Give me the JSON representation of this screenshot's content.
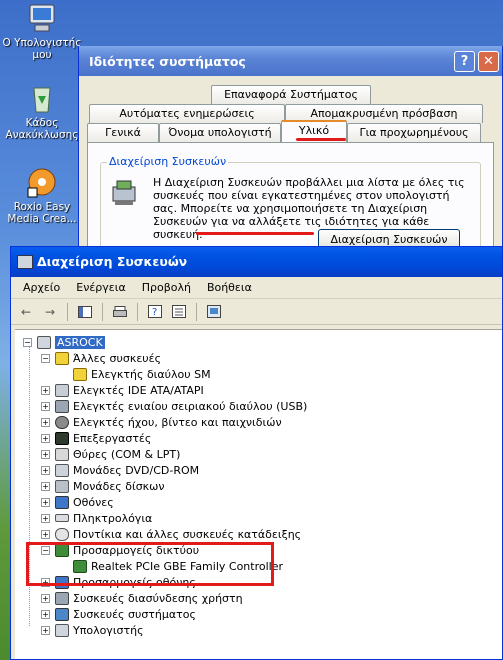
{
  "desktop": {
    "icons": [
      {
        "label": "Ο Υπολογιστής μου"
      },
      {
        "label": "Κάδος Ανακύκλωσης"
      },
      {
        "label": "Roxio Easy Media Crea..."
      }
    ]
  },
  "system_properties": {
    "title": "Ιδιότητες συστήματος",
    "help_btn": "?",
    "close_btn": "✕",
    "tabs_row1": [
      "Επαναφορά Συστήματος"
    ],
    "tabs_row2": [
      "Αυτόματες ενημερώσεις",
      "Απομακρυσμένη πρόσβαση"
    ],
    "tabs_row3": [
      "Γενικά",
      "Όνομα υπολογιστή",
      "Υλικό",
      "Για προχωρημένους"
    ],
    "active_tab": "Υλικό",
    "group_title": "Διαχείριση Συσκευών",
    "group_text": "Η Διαχείριση Συσκευών προβάλλει μια λίστα με όλες τις συσκευές που είναι εγκατεστημένες στον υπολογιστή σας. Μπορείτε να χρησιμοποιήσετε τη Διαχείριση Συσκευών για να αλλάξετε τις ιδιότητες για κάθε συσκευή.",
    "group_button": "Διαχείριση Συσκευών"
  },
  "device_manager": {
    "title": "Διαχείριση Συσκευών",
    "menu": [
      "Αρχείο",
      "Ενέργεια",
      "Προβολή",
      "Βοήθεια"
    ],
    "root": "ASROCK",
    "tree": [
      {
        "label": "Άλλες συσκευές",
        "expanded": true,
        "icon": "question-icon"
      },
      {
        "label": "Ελεγκτής διαύλου SM",
        "child": true,
        "icon": "warning-device-icon"
      },
      {
        "label": "Ελεγκτές IDE ATA/ATAPI",
        "icon": "ide-icon"
      },
      {
        "label": "Ελεγκτές ενιαίου σειριακού διαύλου (USB)",
        "icon": "usb-icon"
      },
      {
        "label": "Ελεγκτές ήχου, βίντεο και παιχνιδιών",
        "icon": "sound-icon"
      },
      {
        "label": "Επεξεργαστές",
        "icon": "cpu-icon"
      },
      {
        "label": "Θύρες (COM & LPT)",
        "icon": "port-icon"
      },
      {
        "label": "Μονάδες DVD/CD-ROM",
        "icon": "dvd-icon"
      },
      {
        "label": "Μονάδες δίσκων",
        "icon": "disk-icon"
      },
      {
        "label": "Οθόνες",
        "icon": "monitor-icon"
      },
      {
        "label": "Πληκτρολόγια",
        "icon": "keyboard-icon"
      },
      {
        "label": "Ποντίκια και άλλες συσκευές κατάδειξης",
        "icon": "mouse-icon"
      },
      {
        "label": "Προσαρμογείς δικτύου",
        "expanded": true,
        "icon": "network-icon"
      },
      {
        "label": "Realtek PCIe GBE Family Controller",
        "child": true,
        "icon": "network-card-icon"
      },
      {
        "label": "Προσαρμογείς οθόνης",
        "icon": "display-adapter-icon"
      },
      {
        "label": "Συσκευές διασύνδεσης χρήστη",
        "icon": "hid-icon"
      },
      {
        "label": "Συσκευές συστήματος",
        "icon": "system-icon"
      },
      {
        "label": "Υπολογιστής",
        "icon": "computer-icon"
      }
    ]
  }
}
